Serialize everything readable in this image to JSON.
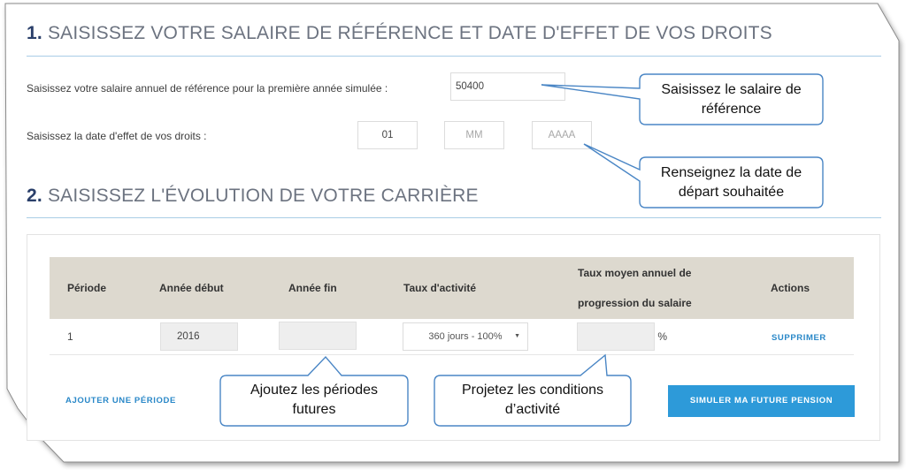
{
  "section1": {
    "number": "1.",
    "title": "SAISISSEZ VOTRE SALAIRE DE RÉFÉRENCE ET DATE D'EFFET DE VOS DROITS",
    "salary_label": "Saisissez votre salaire annuel de référence pour la première année simulée :",
    "salary_value": "50400",
    "date_label": "Saisissez la date d'effet de vos droits :",
    "date_day": "01",
    "date_month_placeholder": "MM",
    "date_year_placeholder": "AAAA"
  },
  "section2": {
    "number": "2.",
    "title": "SAISISSEZ L'ÉVOLUTION DE VOTRE CARRIÈRE",
    "table": {
      "headers": {
        "period": "Période",
        "start_year": "Année début",
        "end_year": "Année fin",
        "activity_rate": "Taux d'activité",
        "progression_line1": "Taux moyen annuel de",
        "progression_line2": "progression du salaire",
        "actions": "Actions"
      },
      "rows": [
        {
          "period": "1",
          "start_year": "2016",
          "end_year": "",
          "activity_rate": "360 jours - 100%",
          "progression": "",
          "unit": "%",
          "action": "SUPPRIMER"
        }
      ]
    },
    "add_period_label": "AJOUTER UNE PÉRIODE",
    "simulate_label": "SIMULER MA FUTURE PENSION"
  },
  "callouts": {
    "salary_line1": "Saisissez le salaire de",
    "salary_line2": "référence",
    "date_line1": "Renseignez la date de",
    "date_line2": "départ souhaitée",
    "periods_line1": "Ajoutez les périodes",
    "periods_line2": "futures",
    "conditions_line1": "Projetez les conditions",
    "conditions_line2": "d’activité"
  },
  "colors": {
    "section_number": "#2a3f6a",
    "title_gray": "#6c7380",
    "rule_blue": "#a9cde6",
    "table_header": "#ddd9cf",
    "link_blue": "#2a88c8",
    "button_blue": "#2d9ad9",
    "callout_border": "#4a86c5"
  }
}
